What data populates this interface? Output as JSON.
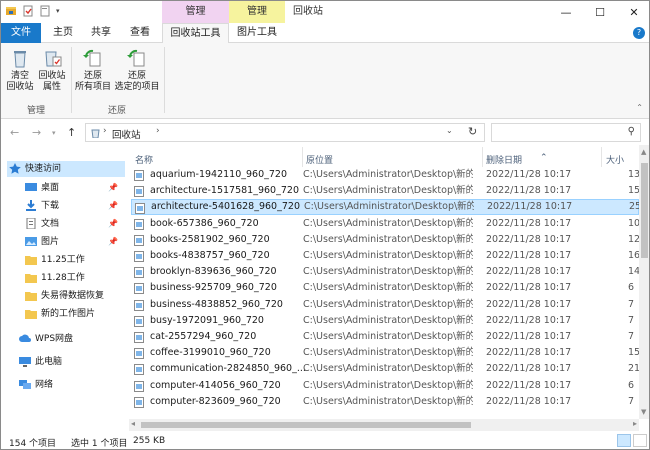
{
  "title": {
    "context_tab_manage_1": "管理",
    "context_tab_manage_2": "管理",
    "window_title": "回收站"
  },
  "ribbon_tabs": {
    "file": "文件",
    "home": "主页",
    "share": "共享",
    "view": "查看",
    "recycle_tools": "回收站工具",
    "picture_tools": "图片工具"
  },
  "ribbon": {
    "empty_line1": "清空",
    "empty_line2": "回收站",
    "props_line1": "回收站",
    "props_line2": "属性",
    "group_manage": "管理",
    "restore_all_line1": "还原",
    "restore_all_line2": "所有项目",
    "restore_sel_line1": "还原",
    "restore_sel_line2": "选定的项目",
    "group_restore": "还原"
  },
  "address": {
    "path": "回收站",
    "search_placeholder": ""
  },
  "navpane": {
    "quick_access": "快速访问",
    "items": [
      {
        "label": "桌面",
        "icon": "desktop-icon",
        "pinned": true
      },
      {
        "label": "下载",
        "icon": "download-icon",
        "pinned": true
      },
      {
        "label": "文档",
        "icon": "document-icon",
        "pinned": true
      },
      {
        "label": "图片",
        "icon": "picture-icon",
        "pinned": true
      },
      {
        "label": "11.25工作",
        "icon": "folder-icon",
        "pinned": false
      },
      {
        "label": "11.28工作",
        "icon": "folder-icon",
        "pinned": false
      },
      {
        "label": "失易得数据恢复",
        "icon": "folder-icon",
        "pinned": false
      },
      {
        "label": "新的工作图片",
        "icon": "folder-icon",
        "pinned": false
      }
    ],
    "wps": "WPS网盘",
    "this_pc": "此电脑",
    "network": "网络"
  },
  "columns": {
    "name": "名称",
    "location": "原位置",
    "deleted": "删除日期",
    "size": "大小"
  },
  "files": [
    {
      "name": "aquarium-1942110_960_720",
      "location": "C:\\Users\\Administrator\\Desktop\\新的...",
      "date": "2022/11/28 10:17",
      "size": "13"
    },
    {
      "name": "architecture-1517581_960_720",
      "location": "C:\\Users\\Administrator\\Desktop\\新的...",
      "date": "2022/11/28 10:17",
      "size": "15"
    },
    {
      "name": "architecture-5401628_960_720",
      "location": "C:\\Users\\Administrator\\Desktop\\新的...",
      "date": "2022/11/28 10:17",
      "size": "25",
      "selected": true
    },
    {
      "name": "book-657386_960_720",
      "location": "C:\\Users\\Administrator\\Desktop\\新的...",
      "date": "2022/11/28 10:17",
      "size": "10"
    },
    {
      "name": "books-2581902_960_720",
      "location": "C:\\Users\\Administrator\\Desktop\\新的...",
      "date": "2022/11/28 10:17",
      "size": "12"
    },
    {
      "name": "books-4838757_960_720",
      "location": "C:\\Users\\Administrator\\Desktop\\新的...",
      "date": "2022/11/28 10:17",
      "size": "16"
    },
    {
      "name": "brooklyn-839636_960_720",
      "location": "C:\\Users\\Administrator\\Desktop\\新的...",
      "date": "2022/11/28 10:17",
      "size": "14"
    },
    {
      "name": "business-925709_960_720",
      "location": "C:\\Users\\Administrator\\Desktop\\新的...",
      "date": "2022/11/28 10:17",
      "size": "6"
    },
    {
      "name": "business-4838852_960_720",
      "location": "C:\\Users\\Administrator\\Desktop\\新的...",
      "date": "2022/11/28 10:17",
      "size": "7"
    },
    {
      "name": "busy-1972091_960_720",
      "location": "C:\\Users\\Administrator\\Desktop\\新的...",
      "date": "2022/11/28 10:17",
      "size": "7"
    },
    {
      "name": "cat-2557294_960_720",
      "location": "C:\\Users\\Administrator\\Desktop\\新的...",
      "date": "2022/11/28 10:17",
      "size": "7"
    },
    {
      "name": "coffee-3199010_960_720",
      "location": "C:\\Users\\Administrator\\Desktop\\新的...",
      "date": "2022/11/28 10:17",
      "size": "15"
    },
    {
      "name": "communication-2824850_960_...",
      "location": "C:\\Users\\Administrator\\Desktop\\新的...",
      "date": "2022/11/28 10:17",
      "size": "21"
    },
    {
      "name": "computer-414056_960_720",
      "location": "C:\\Users\\Administrator\\Desktop\\新的...",
      "date": "2022/11/28 10:17",
      "size": "6"
    },
    {
      "name": "computer-823609_960_720",
      "location": "C:\\Users\\Administrator\\Desktop\\新的...",
      "date": "2022/11/28 10:17",
      "size": "7"
    }
  ],
  "status": {
    "count": "154 个项目",
    "selection": "选中 1 个项目",
    "size": "255 KB"
  },
  "colors": {
    "accent": "#1979ca",
    "selection": "#cce8ff",
    "context_manage_1": "#f1d3f1",
    "context_manage_2": "#f6f39e"
  }
}
